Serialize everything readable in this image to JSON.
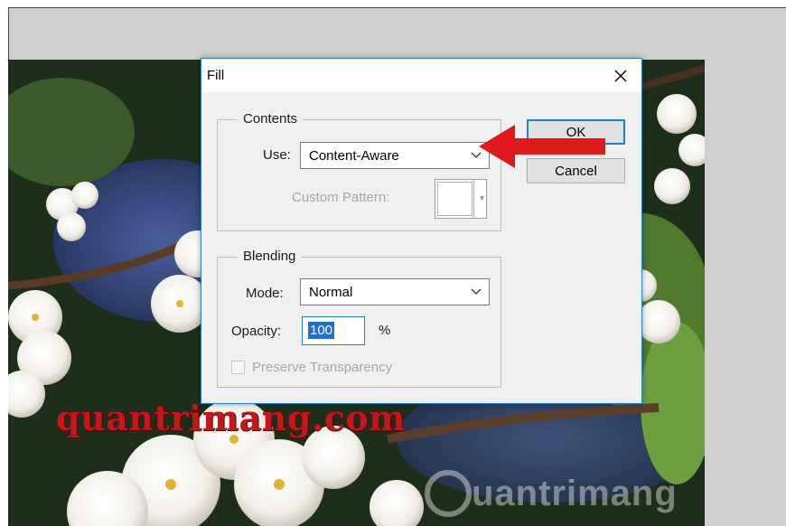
{
  "dialog": {
    "title": "Fill",
    "close_icon": "close-icon",
    "contents": {
      "legend": "Contents",
      "use_label": "Use:",
      "use_value": "Content-Aware",
      "custom_pattern_label": "Custom Pattern:"
    },
    "blending": {
      "legend": "Blending",
      "mode_label": "Mode:",
      "mode_value": "Normal",
      "opacity_label": "Opacity:",
      "opacity_value": "100",
      "opacity_unit": "%",
      "preserve_label": "Preserve Transparency",
      "preserve_checked": false
    },
    "buttons": {
      "ok": "OK",
      "cancel": "Cancel"
    }
  },
  "watermarks": {
    "red": "quantrimang.com",
    "grey": "uantrimang"
  },
  "colors": {
    "accent": "#1e82d4",
    "annotation_arrow": "#e0191b",
    "workspace": "#cfcfcf"
  }
}
